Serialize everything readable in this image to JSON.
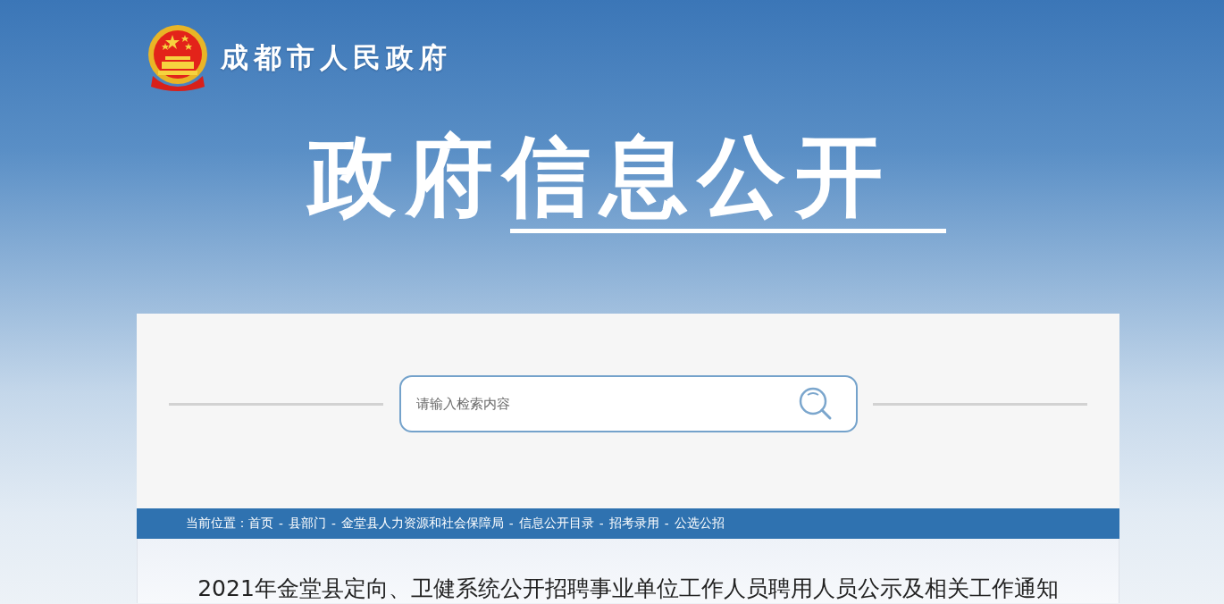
{
  "header": {
    "site_name": "成都市人民政府",
    "banner_title": "政府信息公开"
  },
  "search": {
    "placeholder": "请输入检索内容"
  },
  "breadcrumb": {
    "label": "当前位置：",
    "items": [
      {
        "label": "首页"
      },
      {
        "separator": "-",
        "label": "县部门"
      },
      {
        "separator": "-",
        "label": "金堂县人力资源和社会保障局"
      },
      {
        "separator": "-",
        "label": "信息公开目录"
      },
      {
        "separator": "-",
        "label": "招考录用"
      },
      {
        "separator": "-",
        "label": "公选公招"
      }
    ]
  },
  "article": {
    "title": "2021年金堂县定向、卫健系统公开招聘事业单位工作人员聘用人员公示及相关工作通知"
  }
}
